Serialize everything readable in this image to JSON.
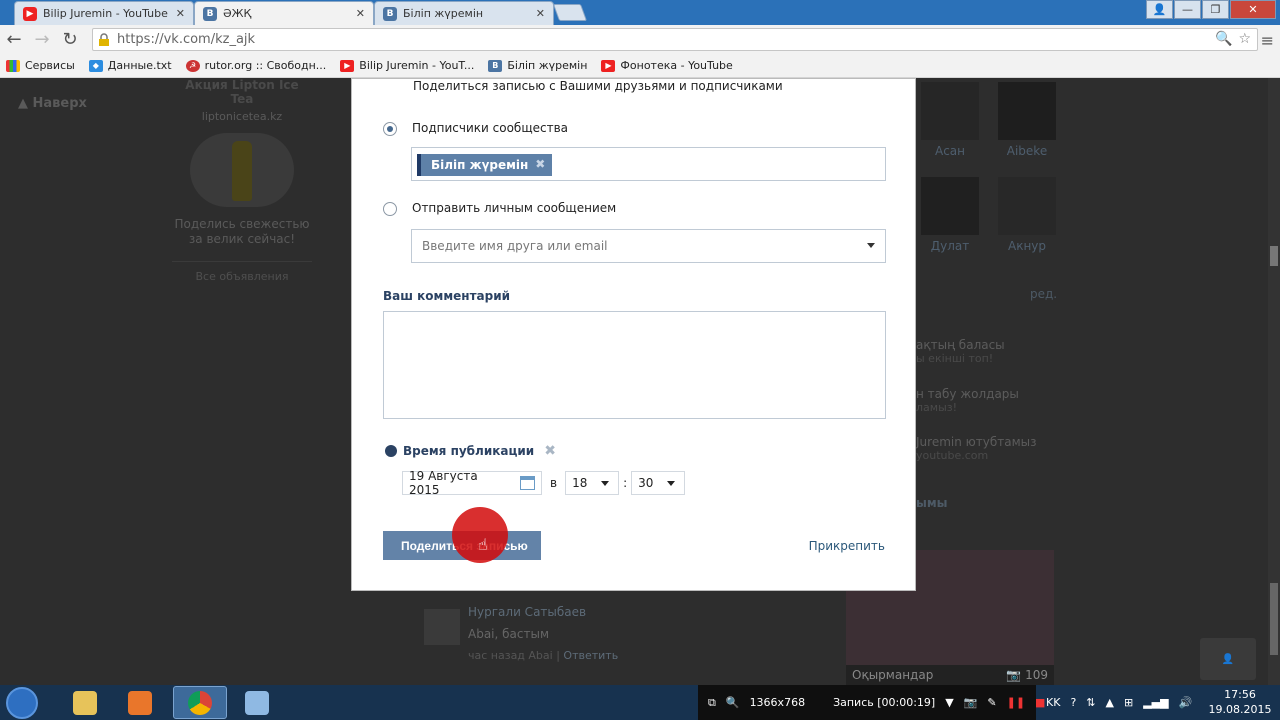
{
  "browser": {
    "tabs": [
      {
        "title": "Bilip Juremin - YouTube",
        "icon": "youtube-icon",
        "active": false
      },
      {
        "title": "ӘЖҚ",
        "icon": "vk-icon",
        "active": true
      },
      {
        "title": "Біліп жүремін",
        "icon": "vk-icon",
        "active": false
      }
    ],
    "url": "https://vk.com/kz_ajk",
    "bookmarks": [
      {
        "label": "Сервисы"
      },
      {
        "label": "Данные.txt"
      },
      {
        "label": "rutor.org :: Свободн..."
      },
      {
        "label": "Bilip Juremin - YouT..."
      },
      {
        "label": "Біліп жүремін"
      },
      {
        "label": "Фонотека - YouTube"
      }
    ]
  },
  "page": {
    "up_label": "Наверх",
    "ad": {
      "title": "Акция Lipton Ice Tea",
      "site": "liptonicetea.kz",
      "text": "Поделись свежестью за велик сейчас!",
      "all_ads": "Все объявления"
    },
    "friends": [
      {
        "name": "Асан"
      },
      {
        "name": "Aibeke"
      },
      {
        "name": "Дулат"
      },
      {
        "name": "Акнур"
      }
    ],
    "edit_link": "ред.",
    "groups": [
      {
        "title": "ақтың баласы",
        "sub": "ы екінші топ!"
      },
      {
        "title": "н табу жолдары",
        "sub": "ламыз!"
      },
      {
        "title": "Juremin ютубтамыз",
        "sub": "youtube.com"
      }
    ],
    "photos_header": "ымы",
    "photo_caption": "Оқырмандар",
    "photo_count": "109",
    "comment": {
      "author": "Нургали Сатыбаев",
      "text": "Abai, бастым",
      "time": "час назад Abai",
      "reply": "Ответить"
    }
  },
  "modal": {
    "top_text": "Поделиться записью с Вашими друзьями и подписчиками",
    "option_subscribers": "Подписчики сообщества",
    "community_chip": "Біліп жүремін",
    "option_message": "Отправить личным сообщением",
    "friend_placeholder": "Введите имя друга или email",
    "comment_title": "Ваш комментарий",
    "pubtime_title": "Время публикации",
    "date": "19 Августа 2015",
    "at": "в",
    "hour": "18",
    "colon": ":",
    "minute": "30",
    "share_button": "Поделиться записью",
    "attach": "Прикрепить"
  },
  "taskbar": {
    "resolution": "1366x768",
    "record": "Запись [00:00:19]",
    "lang": "KK",
    "time": "17:56",
    "date": "19.08.2015"
  }
}
